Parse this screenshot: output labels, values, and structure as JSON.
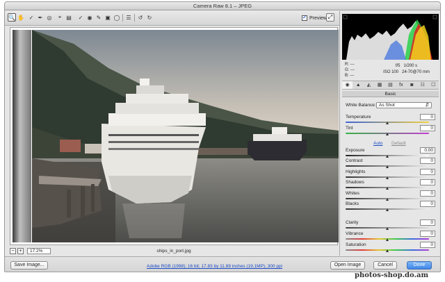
{
  "window": {
    "title": "Camera Raw 8.1  –  JPEG"
  },
  "toolbar": {
    "tools": [
      "zoom-icon",
      "hand-icon",
      "white-balance-icon",
      "color-sampler-icon",
      "target-adjust-icon",
      "crop-icon",
      "straighten-icon",
      "spot-removal-icon",
      "red-eye-icon",
      "adjustment-brush-icon",
      "graduated-filter-icon",
      "radial-filter-icon",
      "preferences-icon",
      "rotate-ccw-icon",
      "rotate-cw-icon"
    ],
    "preview_label": "Preview",
    "preview_checked": true
  },
  "status": {
    "zoom": "17.2%",
    "filename": "ships_in_port.jpg"
  },
  "readout": {
    "r": "R:",
    "g": "G:",
    "b": "B:",
    "dash": "---",
    "aperture": "f/5",
    "shutter": "1/200 s",
    "iso": "ISO 100",
    "lens": "24-70@70 mm"
  },
  "panel": {
    "tabs": [
      "◉",
      "▲",
      "◭",
      "▦",
      "▤",
      "fx",
      "◙",
      "☷",
      "☐"
    ],
    "section_title": "Basic",
    "white_balance": {
      "label": "White Balance:",
      "value": "As Shot"
    },
    "auto_label": "Auto",
    "default_label": "Default",
    "sliders": [
      {
        "label": "Temperature",
        "value": "0",
        "pos": 0.5
      },
      {
        "label": "Tint",
        "value": "0",
        "pos": 0.5
      },
      {
        "label": "Exposure",
        "value": "0.00",
        "pos": 0.5
      },
      {
        "label": "Contrast",
        "value": "0",
        "pos": 0.5
      },
      {
        "label": "Highlights",
        "value": "0",
        "pos": 0.5
      },
      {
        "label": "Shadows",
        "value": "0",
        "pos": 0.5
      },
      {
        "label": "Whites",
        "value": "0",
        "pos": 0.5
      },
      {
        "label": "Blacks",
        "value": "0",
        "pos": 0.5
      },
      {
        "label": "Clarity",
        "value": "0",
        "pos": 0.5
      },
      {
        "label": "Vibrance",
        "value": "0",
        "pos": 0.5
      },
      {
        "label": "Saturation",
        "value": "0",
        "pos": 0.5
      }
    ]
  },
  "bottom": {
    "save_label": "Save Image...",
    "workflow": "Adobe RGB (1998); 16 bit; 17.83 by 11.89 inches (19.1MP); 300 ppi",
    "open_label": "Open Image",
    "cancel_label": "Cancel",
    "done_label": "Done"
  },
  "watermark": "photos-shop.do.am"
}
